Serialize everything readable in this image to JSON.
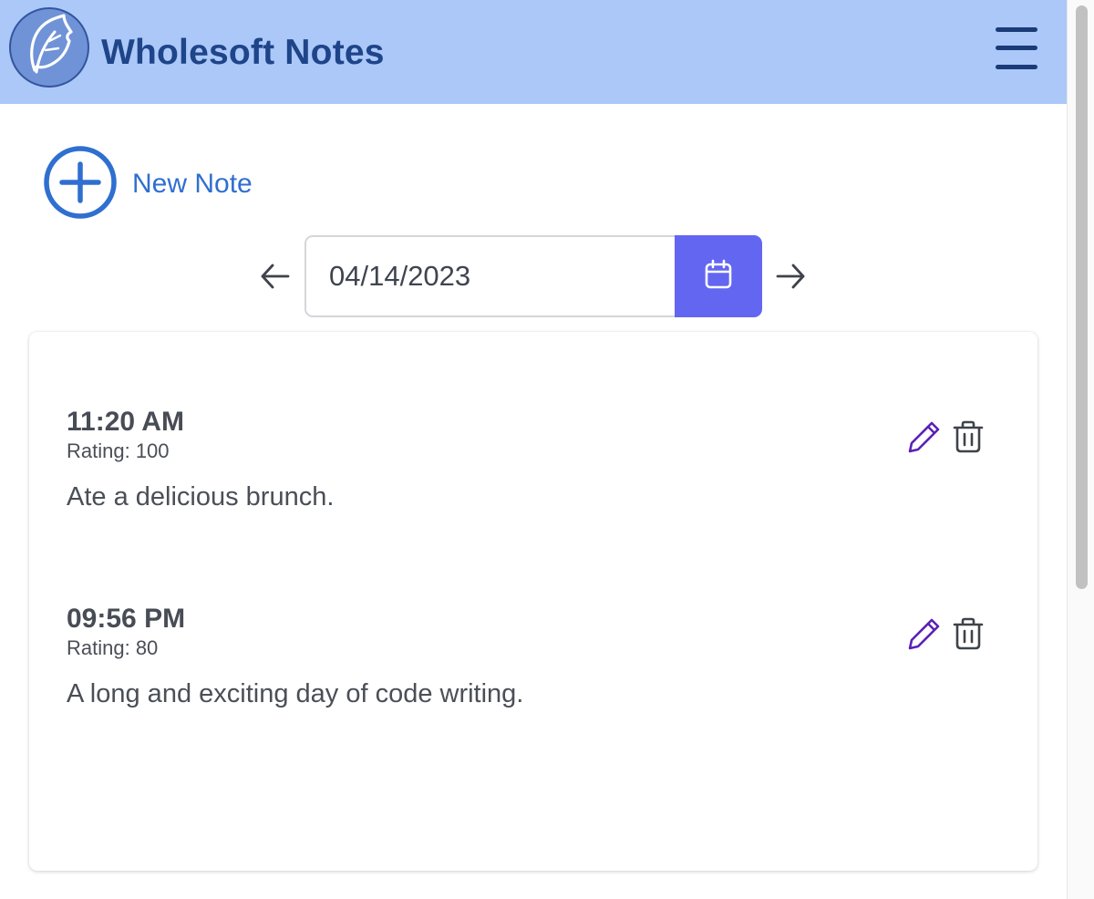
{
  "header": {
    "title": "Wholesoft Notes",
    "logo_icon": "leaf-icon",
    "menu_icon": "hamburger-menu-icon"
  },
  "toolbar": {
    "new_note_label": "New Note",
    "new_note_icon": "plus-circle-icon"
  },
  "date_nav": {
    "date_value": "04/14/2023",
    "prev_icon": "arrow-left-icon",
    "next_icon": "arrow-right-icon",
    "calendar_icon": "calendar-icon"
  },
  "notes": [
    {
      "time": "11:20 AM",
      "rating": "Rating: 100",
      "text": "Ate a delicious brunch."
    },
    {
      "time": "09:56 PM",
      "rating": "Rating: 80",
      "text": "A long and exciting day of code writing."
    }
  ],
  "colors": {
    "header_bg": "#abc8f8",
    "title": "#1e4489",
    "accent_blue": "#2f6fd0",
    "calendar_button": "#6366f1",
    "edit_icon": "#5b21b6",
    "delete_icon": "#3f434a"
  }
}
